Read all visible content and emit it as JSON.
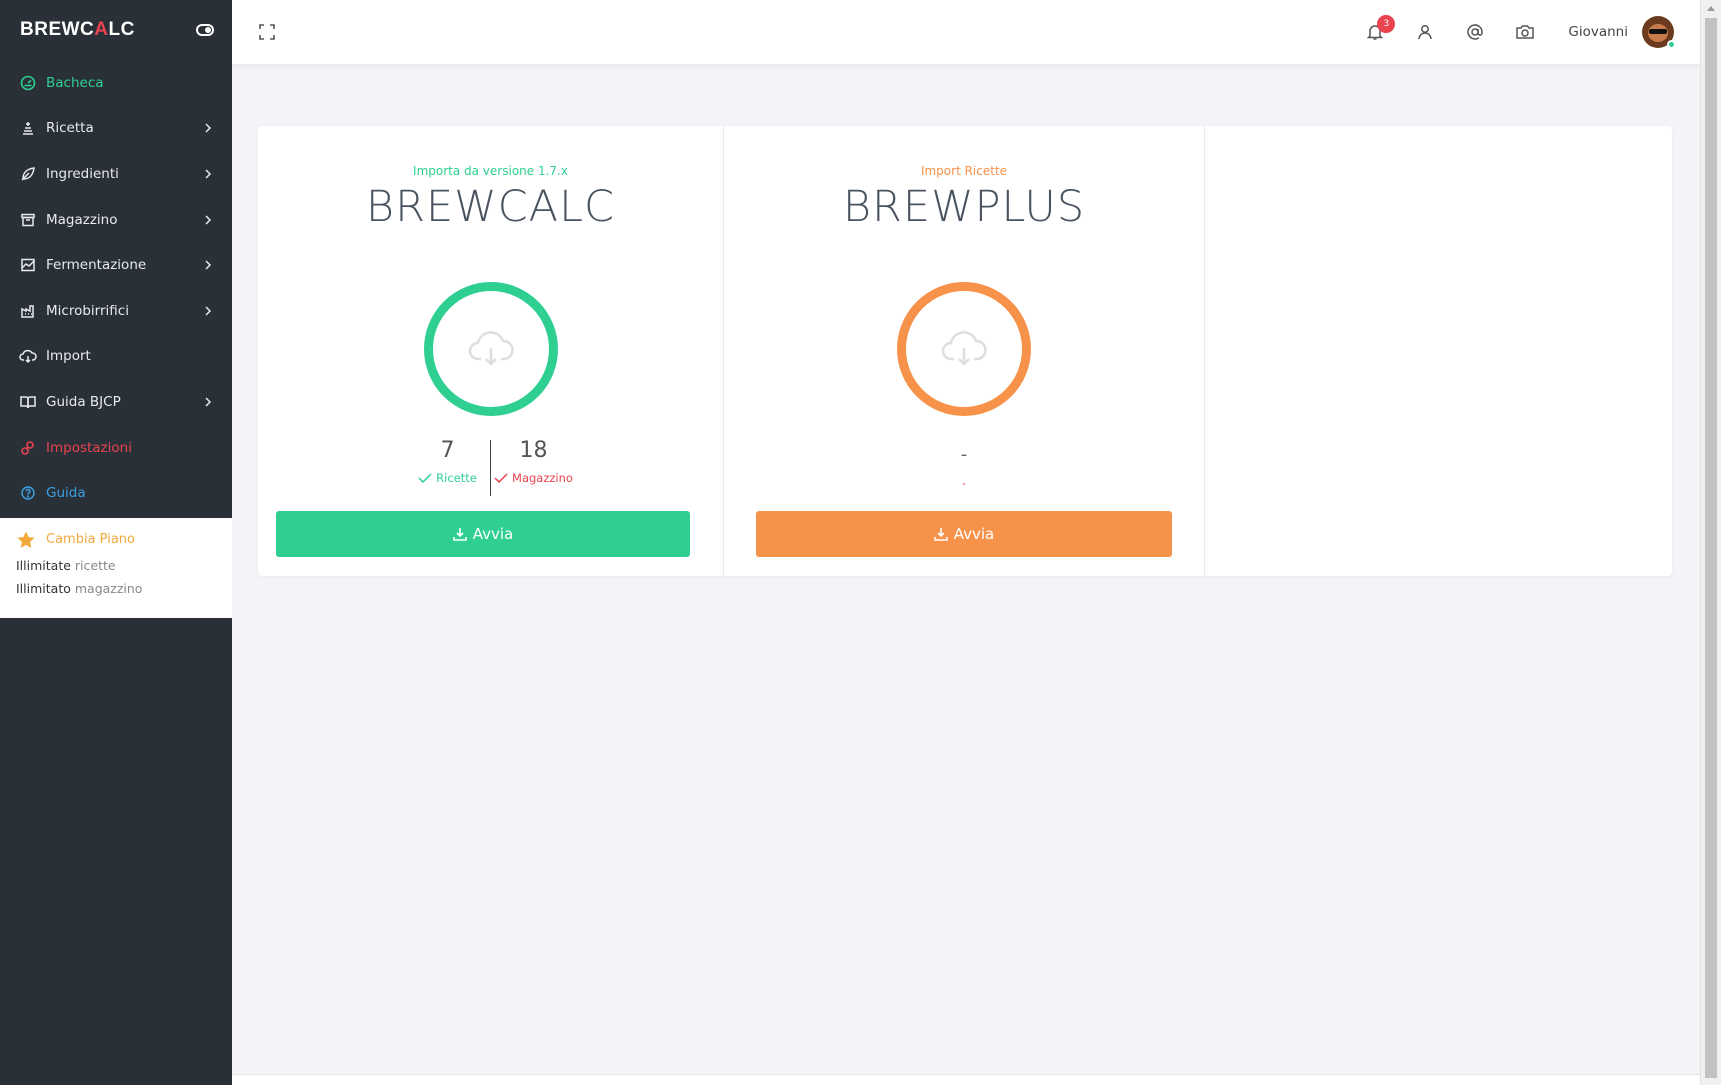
{
  "brand": {
    "name_part1": "BREWC",
    "name_accent": "A",
    "name_part2": "LC"
  },
  "sidebar": {
    "items": [
      {
        "label": "Bacheca",
        "icon": "dashboard-icon",
        "has_chevron": false
      },
      {
        "label": "Ricetta",
        "icon": "recipe-icon",
        "has_chevron": true
      },
      {
        "label": "Ingredienti",
        "icon": "leaf-icon",
        "has_chevron": true
      },
      {
        "label": "Magazzino",
        "icon": "archive-icon",
        "has_chevron": true
      },
      {
        "label": "Fermentazione",
        "icon": "chart-area-icon",
        "has_chevron": true
      },
      {
        "label": "Microbirrifici",
        "icon": "factory-icon",
        "has_chevron": true
      },
      {
        "label": "Import",
        "icon": "cloud-download-icon",
        "has_chevron": false
      },
      {
        "label": "Guida BJCP",
        "icon": "book-icon",
        "has_chevron": true
      },
      {
        "label": "Impostazioni",
        "icon": "settings-icon",
        "has_chevron": false
      },
      {
        "label": "Guida",
        "icon": "help-icon",
        "has_chevron": false
      }
    ],
    "plan": {
      "title": "Cambia Piano",
      "line1_bold": "Illimitate",
      "line1_muted": "ricette",
      "line2_bold": "Illimitato",
      "line2_muted": "magazzino"
    }
  },
  "topbar": {
    "notifications_count": "3",
    "user_name": "Giovanni"
  },
  "imports": [
    {
      "subtitle": "Importa da versione 1.7.x",
      "title": "BREWCALC",
      "stat1_value": "7",
      "stat1_label": "Ricette",
      "stat2_value": "18",
      "stat2_label": "Magazzino",
      "button_label": "Avvia"
    },
    {
      "subtitle": "Import Ricette",
      "title": "BREWPLUS",
      "stat_value": "-",
      "stat_label": "-",
      "button_label": "Avvia"
    }
  ],
  "colors": {
    "sidebar_bg": "#2a3038",
    "green": "#2ecf91",
    "orange": "#f7924a",
    "red": "#e8434f",
    "blue": "#3a9fe0",
    "gold": "#f2a93b"
  }
}
